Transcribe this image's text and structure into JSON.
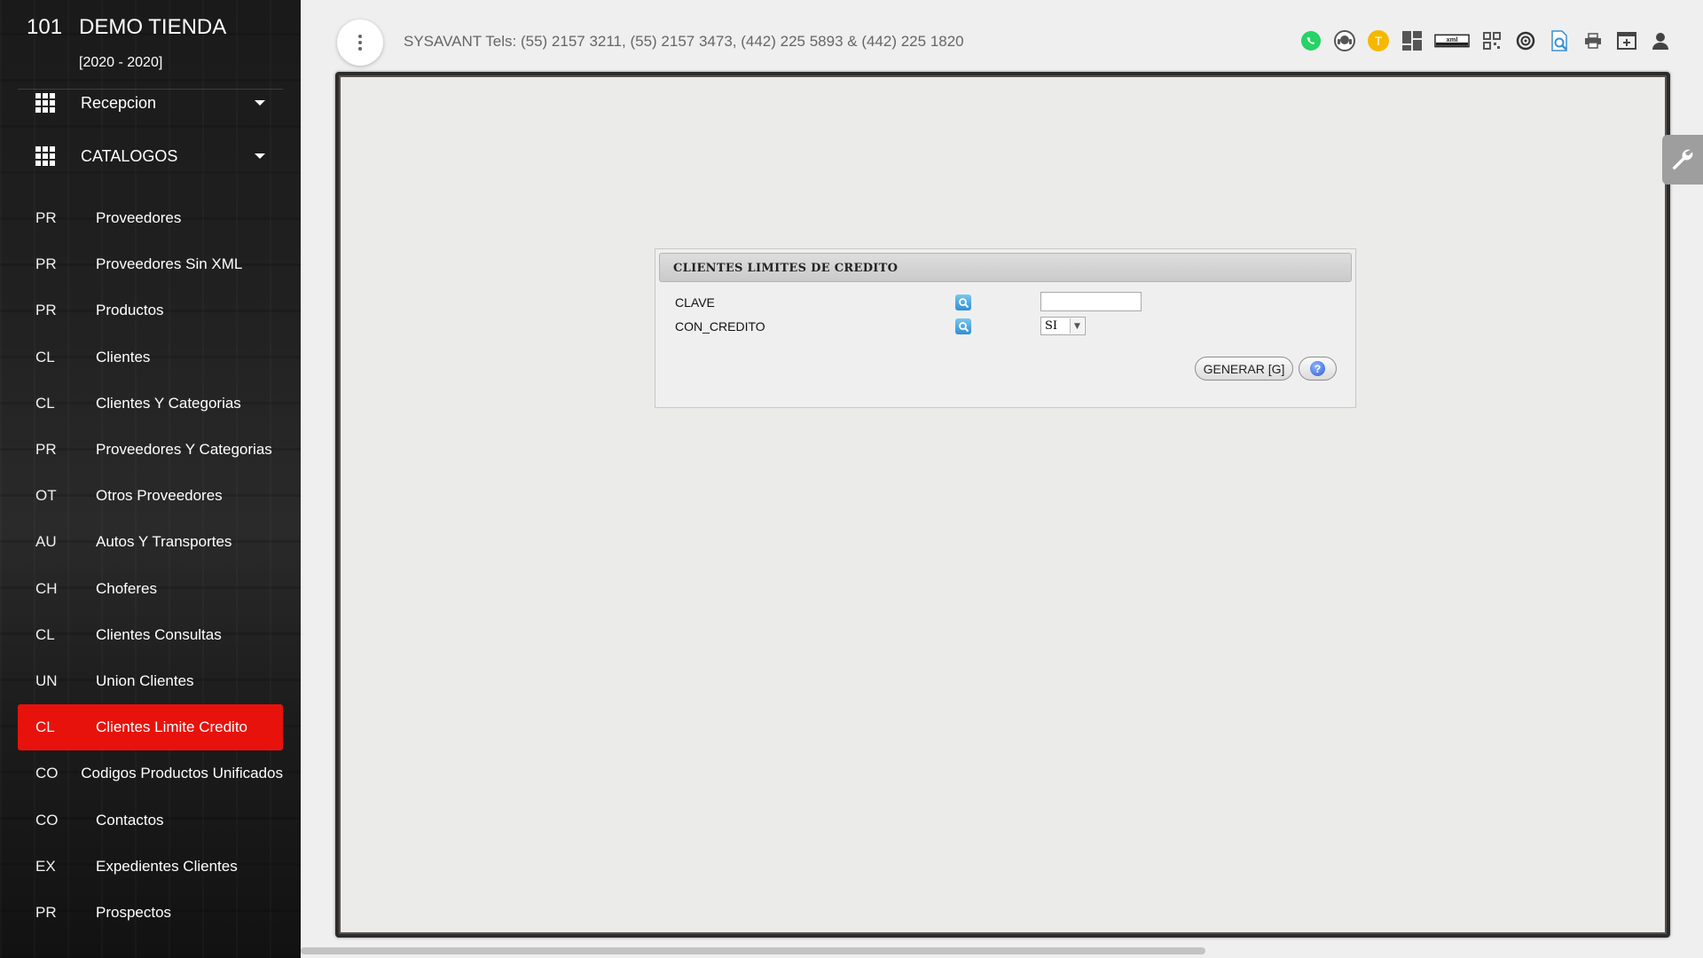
{
  "sidebar": {
    "number": "101",
    "company": "DEMO TIENDA",
    "years": "[2020 - 2020]",
    "groups": [
      {
        "label": "Recepcion"
      },
      {
        "label": "CATALOGOS"
      }
    ],
    "items": [
      {
        "abbr": "PR",
        "label": "Proveedores"
      },
      {
        "abbr": "PR",
        "label": "Proveedores Sin XML"
      },
      {
        "abbr": "PR",
        "label": "Productos"
      },
      {
        "abbr": "CL",
        "label": "Clientes"
      },
      {
        "abbr": "CL",
        "label": "Clientes Y Categorias"
      },
      {
        "abbr": "PR",
        "label": "Proveedores Y Categorias"
      },
      {
        "abbr": "OT",
        "label": "Otros Proveedores"
      },
      {
        "abbr": "AU",
        "label": "Autos Y Transportes"
      },
      {
        "abbr": "CH",
        "label": "Choferes"
      },
      {
        "abbr": "CL",
        "label": "Clientes Consultas"
      },
      {
        "abbr": "UN",
        "label": "Union Clientes"
      },
      {
        "abbr": "CL",
        "label": "Clientes Limite Credito",
        "active": true
      },
      {
        "abbr": "CO",
        "label": "Codigos Productos Unificados"
      },
      {
        "abbr": "CO",
        "label": "Contactos"
      },
      {
        "abbr": "EX",
        "label": "Expedientes Clientes"
      },
      {
        "abbr": "PR",
        "label": "Prospectos"
      }
    ]
  },
  "header": {
    "info": "SYSAVANT Tels: (55) 2157 3211, (55) 2157 3473, (442) 225 5893 & (442) 225 1820",
    "toolbar_icons": [
      "whatsapp-icon",
      "support-chat-icon",
      "t-badge-icon",
      "dashboard-icon",
      "xml-icon",
      "qr-code-icon",
      "target-icon",
      "document-search-icon",
      "printer-icon",
      "window-add-icon",
      "user-icon"
    ],
    "t_badge_letter": "T",
    "xml_text": "xml"
  },
  "dialog": {
    "title": "CLIENTES LIMITES DE CREDITO",
    "fields": [
      {
        "label": "CLAVE",
        "value": ""
      },
      {
        "label": "CON_CREDITO",
        "value": "SI"
      }
    ],
    "generate_label": "GENERAR [G]",
    "help_symbol": "?"
  },
  "colors": {
    "active_item": "#e8120c",
    "sidebar_bg": "#1e1e1e",
    "accent_blue": "#2f8fd4"
  }
}
